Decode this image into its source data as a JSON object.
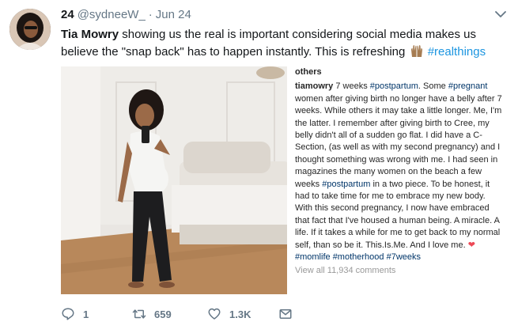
{
  "tweet": {
    "display_name": "24",
    "handle": "@sydneeW_",
    "separator": "·",
    "date": "Jun 24",
    "text_bold": "Tia Mowry",
    "text_main": " showing us the real is important considering social media makes us believe the \"snap back\" has to happen instantly. This is refreshing ",
    "text_hashtag": "#realthings"
  },
  "media": {
    "others_label": "others",
    "caption": {
      "user": "tiamowry",
      "p1": " 7 weeks ",
      "tag1": "#postpartum",
      "p2": ". Some ",
      "tag2": "#pregnant",
      "p3": " women after giving birth no longer have a belly after 7 weeks.  While others it may take a little longer. Me, I'm the latter.  I remember after giving birth to Cree, my belly didn't all of a sudden go flat.  I did have a C-Section, (as well as with my second pregnancy) and I thought something was wrong with me.  I had seen in magazines the many women on the beach a few weeks ",
      "tag3": "#postpartum",
      "p4": " in a two piece. To be honest, it had to take time for me to embrace my new body.  With this second pregnancy, I now have embraced that fact that I've housed a human being.  A miracle.  A life. If it takes a while for me to get back to my normal self, than so be it. This.Is.Me. And I love me. ",
      "heart": "❤",
      "tag4": "#momlife",
      "tag5": "#motherhood",
      "tag6": "#7weeks",
      "view_all": "View all 11,934 comments"
    }
  },
  "actions": {
    "replies": "1",
    "retweets": "659",
    "likes": "1.3K"
  },
  "icons": {
    "reply": "reply-icon",
    "retweet": "retweet-icon",
    "like": "heart-icon",
    "message": "envelope-icon",
    "menu": "chevron-down-icon",
    "emoji": "raised-hands-emoji"
  },
  "colors": {
    "link": "#1b95e0",
    "muted": "#657786",
    "instagram_tag": "#003569"
  }
}
